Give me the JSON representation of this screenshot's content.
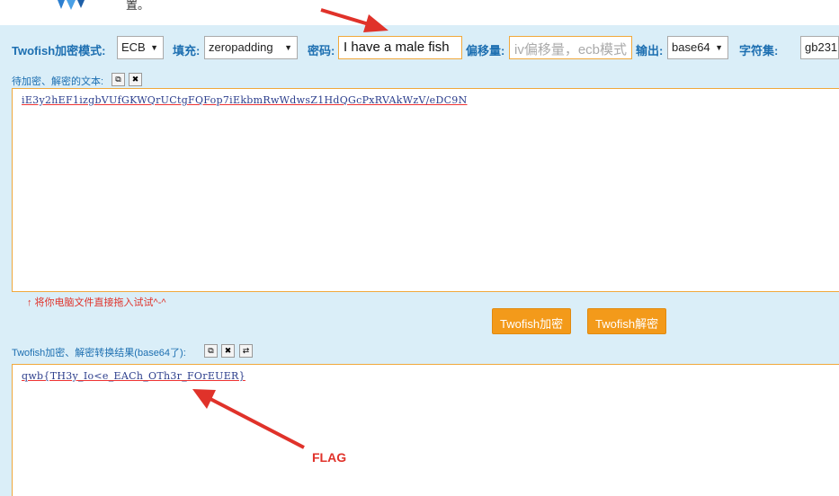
{
  "topbar": {
    "text": "置。",
    "logo_icon": "logo-icon"
  },
  "toolbar": {
    "mode_label": "Twofish加密模式:",
    "mode_value": "ECB",
    "padding_label": "填充:",
    "padding_value": "zeropadding",
    "password_label": "密码:",
    "password_value": "I have a male fish",
    "iv_label": "偏移量:",
    "iv_placeholder": "iv偏移量，ecb模式",
    "output_label": "输出:",
    "output_value": "base64",
    "charset_label": "字符集:",
    "charset_value": "gb231"
  },
  "input_section": {
    "label": "待加密、解密的文本:",
    "text": "iE3y2hEF1izgbVUfGKWQrUCtgFQFop7iEkbmRwWdwsZ1HdQGcPxRVAkWzV/eDC9N",
    "hint": "↑ 将你电脑文件直接拖入试试^-^"
  },
  "actions": {
    "encrypt_label": "Twofish加密",
    "decrypt_label": "Twofish解密"
  },
  "output_section": {
    "label": "Twofish加密、解密转换结果(base64了):",
    "text": "qwb{TH3y_Io<e_EACh_OTh3r_FOrEUER}"
  },
  "annotation": {
    "flag_label": "FLAG",
    "color": "#e0322a"
  },
  "colors": {
    "panel_bg": "#daeef8",
    "label_blue": "#1d6fb1",
    "accent_orange": "#f39a1a",
    "input_border": "#f0a83c"
  }
}
